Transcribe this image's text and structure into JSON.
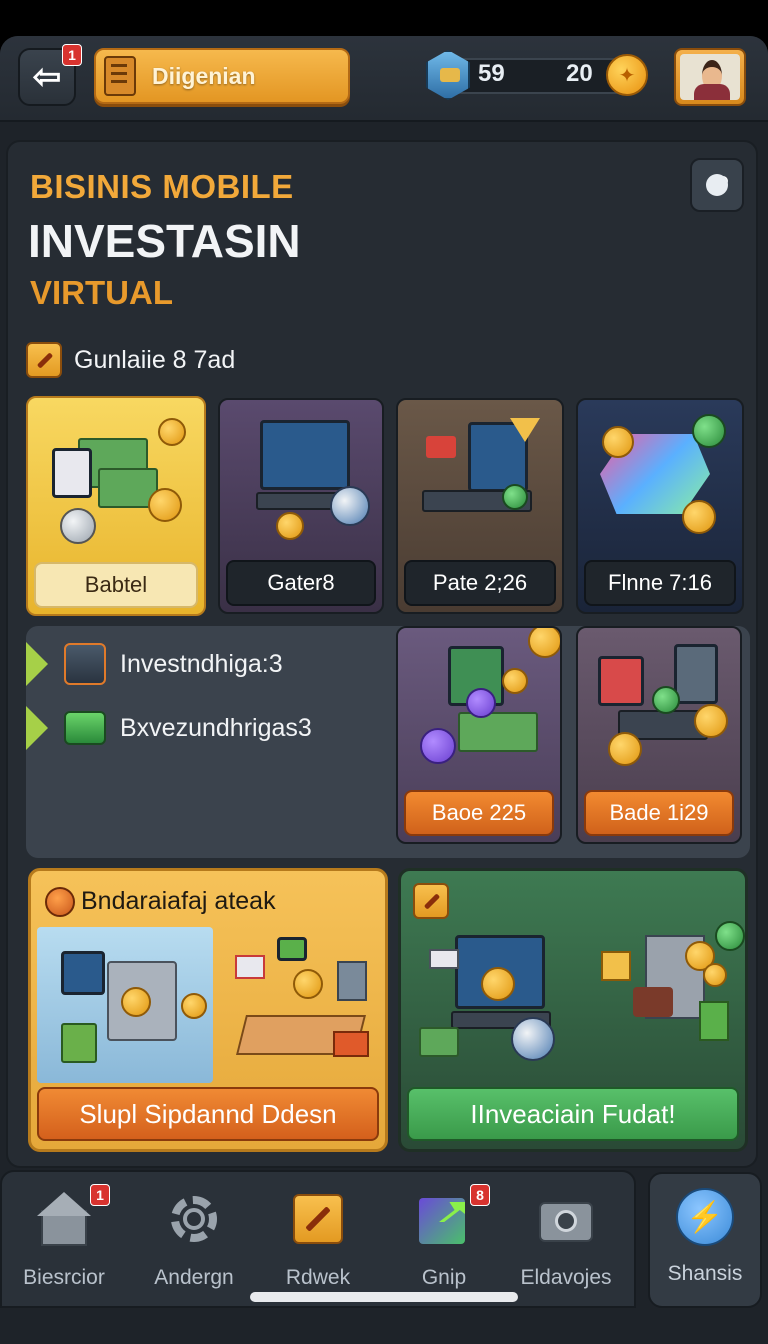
{
  "header": {
    "back_badge": "1",
    "title_button": "Diigenian",
    "resource_gems": "59",
    "resource_coins": "20"
  },
  "hero": {
    "line1": "BISINIS MOBILE",
    "line2": "INVESTASIN",
    "line3": "VIRTUAL"
  },
  "section": {
    "title": "Gunlaiie 8 7ad"
  },
  "cards": [
    {
      "label": "Babtel"
    },
    {
      "label": "Gater8"
    },
    {
      "label": "Pate 2;26"
    },
    {
      "label": "Flnne 7:16"
    },
    {
      "label": "Baoe 225"
    },
    {
      "label": "Bade 1i29"
    }
  ],
  "side_list": [
    {
      "label": "Investndhiga:3"
    },
    {
      "label": "Bxvezundhrigas3"
    }
  ],
  "promos": {
    "left_title": "Bndaraiafaj ateak",
    "left_button": "Slupl Sipdannd Ddesn",
    "right_button": "IInveaciain Fudat!"
  },
  "nav": [
    {
      "label": "Biesrcior",
      "badge": "1"
    },
    {
      "label": "Andergn"
    },
    {
      "label": "Rdwek"
    },
    {
      "label": "Gnip",
      "badge": "8"
    },
    {
      "label": "Eldavojes"
    }
  ],
  "nav_action": {
    "label": "Shansis"
  },
  "colors": {
    "accent_orange": "#f2a93a",
    "accent_green": "#4caf5a",
    "panel": "#262c33"
  }
}
